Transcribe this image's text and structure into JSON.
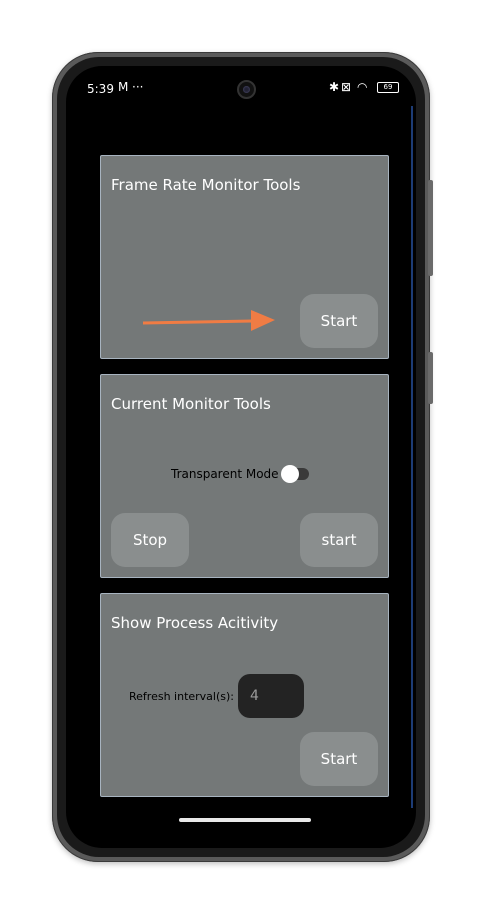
{
  "status_bar": {
    "time": "5:39",
    "left_icons": [
      "mail-icon",
      "more-dots-icon"
    ],
    "right_icons": [
      "bluetooth-icon",
      "no-sim-icon",
      "wifi-icon"
    ],
    "battery": "69"
  },
  "cards": {
    "frame_rate": {
      "title": "Frame Rate Monitor Tools",
      "start_label": "Start"
    },
    "current_monitor": {
      "title": "Current Monitor Tools",
      "transparent_mode_label": "Transparent Mode",
      "transparent_mode_on": false,
      "stop_label": "Stop",
      "start_label": "start"
    },
    "process_activity": {
      "title": "Show Process Acitivity",
      "interval_label": "Refresh interval(s):",
      "interval_value": "4",
      "start_label": "Start"
    }
  },
  "annotation": {
    "arrow_color": "#f07c44"
  },
  "colors": {
    "card_bg": "#747878",
    "button_bg": "#8a8e8e",
    "screen_bg": "#000000"
  }
}
